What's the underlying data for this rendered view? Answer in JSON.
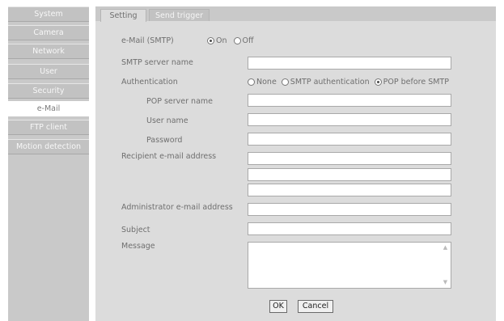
{
  "sidebar": {
    "items": [
      {
        "label": "System"
      },
      {
        "label": "Camera"
      },
      {
        "label": "Network"
      },
      {
        "label": "User"
      },
      {
        "label": "Security"
      },
      {
        "label": "e-Mail",
        "active": true
      },
      {
        "label": "FTP client"
      },
      {
        "label": "Motion detection"
      }
    ]
  },
  "tabs": {
    "setting": "Setting",
    "send_trigger": "Send trigger"
  },
  "form": {
    "email_smtp_label": "e-Mail (SMTP)",
    "email_on": "On",
    "email_off": "Off",
    "email_selected": "On",
    "smtp_server_label": "SMTP server name",
    "smtp_server_value": "",
    "auth_label": "Authentication",
    "auth_none": "None",
    "auth_smtp": "SMTP authentication",
    "auth_pop": "POP before SMTP",
    "auth_selected": "POP before SMTP",
    "pop_server_label": "POP server name",
    "pop_server_value": "",
    "user_name_label": "User name",
    "user_name_value": "",
    "password_label": "Password",
    "password_value": "",
    "recipient_label": "Recipient e-mail address",
    "recipient_values": [
      "",
      "",
      ""
    ],
    "admin_label": "Administrator e-mail address",
    "admin_value": "",
    "subject_label": "Subject",
    "subject_value": "",
    "message_label": "Message",
    "message_value": ""
  },
  "buttons": {
    "ok": "OK",
    "cancel": "Cancel"
  },
  "colors": {
    "sidebar_bg": "#c9c9c9",
    "content_bg": "#dcdcdc",
    "text": "#6f6f6f"
  }
}
